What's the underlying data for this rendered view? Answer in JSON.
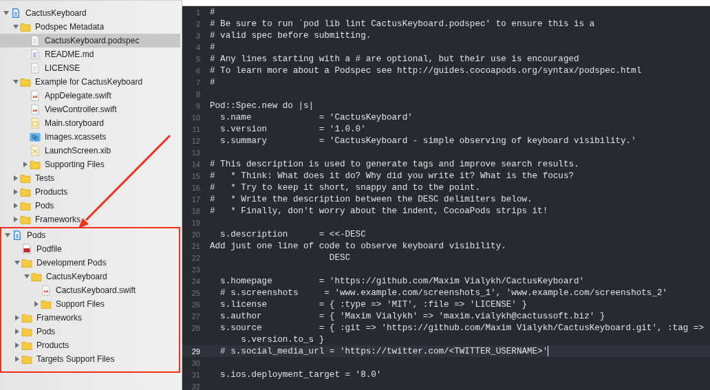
{
  "sidebar": {
    "tree": [
      {
        "label": "CactusKeyboard",
        "kind": "project",
        "expanded": true,
        "selected": false,
        "highlighted": false,
        "children": [
          {
            "label": "Podspec Metadata",
            "kind": "folder",
            "expanded": true,
            "selected": false,
            "children": [
              {
                "label": "CactusKeyboard.podspec",
                "kind": "doc",
                "selected": true
              },
              {
                "label": "README.md",
                "kind": "text",
                "selected": false
              },
              {
                "label": "LICENSE",
                "kind": "doc",
                "selected": false
              }
            ]
          },
          {
            "label": "Example for CactusKeyboard",
            "kind": "folder",
            "expanded": true,
            "selected": false,
            "children": [
              {
                "label": "AppDelegate.swift",
                "kind": "swift",
                "selected": false
              },
              {
                "label": "ViewController.swift",
                "kind": "swift",
                "selected": false
              },
              {
                "label": "Main.storyboard",
                "kind": "storyboard",
                "selected": false
              },
              {
                "label": "Images.xcassets",
                "kind": "assets",
                "selected": false
              },
              {
                "label": "LaunchScreen.xib",
                "kind": "xib",
                "selected": false
              },
              {
                "label": "Supporting Files",
                "kind": "folder",
                "expanded": false,
                "selected": false
              }
            ]
          },
          {
            "label": "Tests",
            "kind": "folder",
            "expanded": false,
            "selected": false
          },
          {
            "label": "Products",
            "kind": "folder",
            "expanded": false,
            "selected": false
          },
          {
            "label": "Pods",
            "kind": "folder",
            "expanded": false,
            "selected": false
          },
          {
            "label": "Frameworks",
            "kind": "folder",
            "expanded": false,
            "selected": false
          }
        ]
      },
      {
        "label": "Pods",
        "kind": "project",
        "expanded": true,
        "selected": false,
        "highlighted": true,
        "children": [
          {
            "label": "Podfile",
            "kind": "ruby",
            "selected": false
          },
          {
            "label": "Development Pods",
            "kind": "folder",
            "expanded": true,
            "selected": false,
            "children": [
              {
                "label": "CactusKeyboard",
                "kind": "folder",
                "expanded": true,
                "selected": false,
                "children": [
                  {
                    "label": "CactusKeyboard.swift",
                    "kind": "swift",
                    "selected": false
                  },
                  {
                    "label": "Support Files",
                    "kind": "folder",
                    "expanded": false,
                    "selected": false
                  }
                ]
              }
            ]
          },
          {
            "label": "Frameworks",
            "kind": "folder",
            "expanded": false,
            "selected": false
          },
          {
            "label": "Pods",
            "kind": "folder",
            "expanded": false,
            "selected": false
          },
          {
            "label": "Products",
            "kind": "folder",
            "expanded": false,
            "selected": false
          },
          {
            "label": "Targets Support Files",
            "kind": "folder",
            "expanded": false,
            "selected": false
          }
        ]
      }
    ]
  },
  "annotation": {
    "arrow_shown": true
  },
  "editor": {
    "lines": [
      {
        "number": "1",
        "text": "#",
        "current": false
      },
      {
        "number": "2",
        "text": "# Be sure to run `pod lib lint CactusKeyboard.podspec' to ensure this is a",
        "current": false
      },
      {
        "number": "3",
        "text": "# valid spec before submitting.",
        "current": false
      },
      {
        "number": "4",
        "text": "#",
        "current": false
      },
      {
        "number": "5",
        "text": "# Any lines starting with a # are optional, but their use is encouraged",
        "current": false
      },
      {
        "number": "6",
        "text": "# To learn more about a Podspec see http://guides.cocoapods.org/syntax/podspec.html",
        "current": false
      },
      {
        "number": "7",
        "text": "#",
        "current": false
      },
      {
        "number": "8",
        "current": false
      },
      {
        "number": "9",
        "text": "Pod::Spec.new do |s|",
        "current": false
      },
      {
        "number": "10",
        "text": "  s.name             = 'CactusKeyboard'",
        "current": false
      },
      {
        "number": "11",
        "text": "  s.version          = '1.0.0'",
        "current": false
      },
      {
        "number": "12",
        "text": "  s.summary          = 'CactusKeyboard - simple observing of keyboard visibility.'",
        "current": false
      },
      {
        "number": "13",
        "current": false
      },
      {
        "number": "14",
        "text": "# This description is used to generate tags and improve search results.",
        "current": false
      },
      {
        "number": "15",
        "text": "#   * Think: What does it do? Why did you write it? What is the focus?",
        "current": false
      },
      {
        "number": "16",
        "text": "#   * Try to keep it short, snappy and to the point.",
        "current": false
      },
      {
        "number": "17",
        "text": "#   * Write the description between the DESC delimiters below.",
        "current": false
      },
      {
        "number": "18",
        "text": "#   * Finally, don't worry about the indent, CocoaPods strips it!",
        "current": false
      },
      {
        "number": "19",
        "current": false
      },
      {
        "number": "20",
        "text": "  s.description      = <<-DESC",
        "current": false
      },
      {
        "number": "21",
        "text": "Add just one line of code to observe keyboard visibility.",
        "current": false
      },
      {
        "number": "22",
        "text": "                       DESC",
        "current": false
      },
      {
        "number": "23",
        "current": false
      },
      {
        "number": "24",
        "text": "  s.homepage         = 'https://github.com/Maxim Vialykh/CactusKeyboard'",
        "current": false
      },
      {
        "number": "25",
        "text": "  # s.screenshots     = 'www.example.com/screenshots_1', 'www.example.com/screenshots_2'",
        "current": false
      },
      {
        "number": "26",
        "text": "  s.license          = { :type => 'MIT', :file => 'LICENSE' }",
        "current": false
      },
      {
        "number": "27",
        "text": "  s.author           = { 'Maxim Vialykh' => 'maxim.vialykh@cactussoft.biz' }",
        "current": false
      },
      {
        "number": "28",
        "text": "  s.source           = { :git => 'https://github.com/Maxim Vialykh/CactusKeyboard.git', :tag =>",
        "continuation": "s.version.to_s }",
        "current": false
      },
      {
        "number": "29",
        "text": "  # s.social_media_url = 'https://twitter.com/<TWITTER_USERNAME>'",
        "current": true
      },
      {
        "number": "30",
        "current": false
      },
      {
        "number": "31",
        "text": "  s.ios.deployment_target = '8.0'",
        "current": false
      },
      {
        "number": "32",
        "current": false
      }
    ]
  }
}
